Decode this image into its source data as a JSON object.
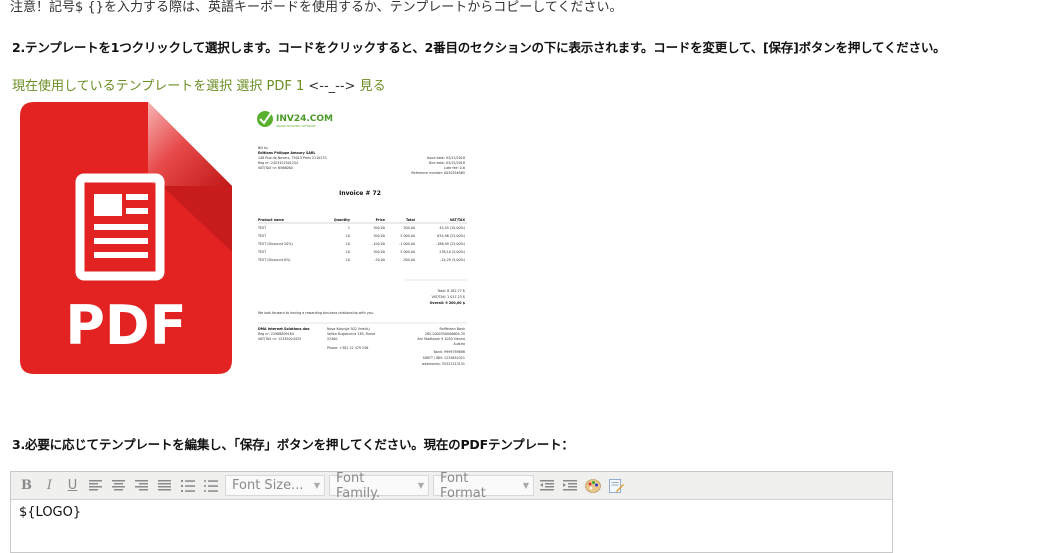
{
  "notice": "注意！記号$ {}を入力する際は、英語キーボードを使用するか、テンプレートからコピーしてください。",
  "step2": "2.テンプレートを1つクリックして選択します。コードをクリックすると、2番目のセクションの下に表示されます。コードを変更して、[保存]ボタンを押してください。",
  "template_links": {
    "current": "現在使用しているテンプレートを選択",
    "select": "選択 PDF 1",
    "arrow": "<--_-->",
    "view": "見る"
  },
  "pdf_icon": {
    "label": "PDF",
    "red": "#e32222",
    "dark_red": "#b31818"
  },
  "invoice": {
    "brand": "INV24.COM",
    "brand_sub": "ONLINE INVOICING SOFTWARE",
    "bill_to": "Bill to:",
    "company": "Editions Philippe Amoury SARL",
    "address": "148 Rue de Nevers, 75015 Paris 2110233",
    "reg": "Reg nr: 2423422301234",
    "vat": "VAT/TAX nr: 6566060",
    "issue": "Issue date: 03/12/2018",
    "due": "Due date: 03/15/2018",
    "late_fee": "Late fee: 0.8",
    "ref": "Reference number: 0030356565",
    "title": "Invoice # 72",
    "headers": [
      "Product name",
      "Quantity",
      "Price",
      "Total",
      "VAT/TAX"
    ],
    "rows": [
      [
        "TEST",
        "1",
        "500,00",
        "500,00",
        "45,45 (10,00%)"
      ],
      [
        "TEST",
        "10",
        "500,00",
        "5 000,00",
        "634,96 (23,00%)"
      ],
      [
        "TEST (Discount 20%)",
        "10",
        "-100,00",
        "-1 000,00",
        "-186,99 (23,00%)"
      ],
      [
        "TEST",
        "10",
        "500,00",
        "5 000,00",
        "238,10 (5,00%)"
      ],
      [
        "TEST (Discount 8%)",
        "10",
        "-30,00",
        "-300,00",
        "-14,29 (5,00%)"
      ]
    ],
    "total": "Total: 8 182,77 $",
    "vat_total": "VAT/TAX: 1 017,23 $",
    "overall": "Overall: 9 200,00 $",
    "thanks": "We look forward to having a rewarding business relationship with you.",
    "footer_company": "DMA Internet Solutions doo",
    "footer_reg": "Reg nr: 22988809184",
    "footer_vat": "VAT/TAX nr: 12345024433",
    "footer_addr1": "Nova Kolonija 502 Vrdnik,j",
    "footer_addr2": "Velika Dugolucica 13B, Ruma",
    "footer_addr3": "22400",
    "footer_phone": "Phone: +381 22 479 236",
    "bank": "Raiffeisen Bank",
    "bank_iban": "265-2000350006609-35",
    "bank_addr": "Am Stadtpark 9 1030 Vienna",
    "bank_country": "Austria",
    "bank_nr": "Bank: 9999789898",
    "swift": "SWIFT / IBN: 1235654321",
    "webmoney": "webmoney: 55321313131"
  },
  "step3": "3.必要に応じてテンプレートを編集し、「保存」ボタンを押してください。現在のPDFテンプレート：",
  "editor": {
    "font_size": "Font Size...",
    "font_family": "Font Family.",
    "font_format": "Font Format",
    "content": "${LOGO}"
  }
}
